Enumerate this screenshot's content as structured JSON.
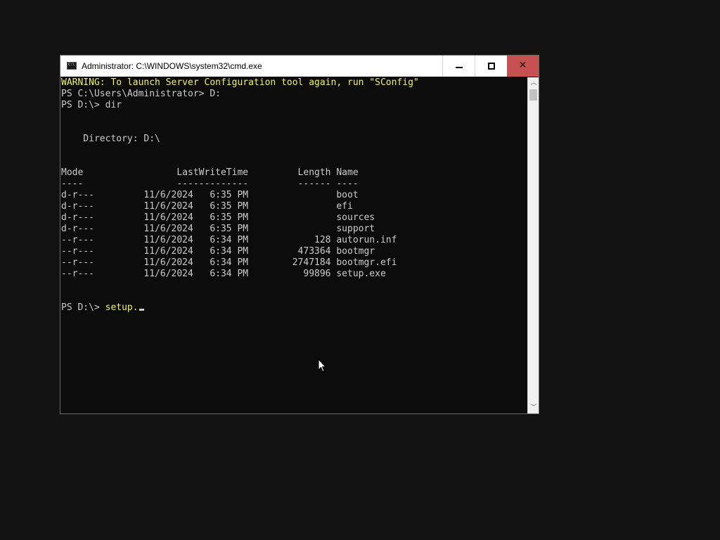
{
  "window": {
    "title": "Administrator: C:\\WINDOWS\\system32\\cmd.exe",
    "icon_label": "C:\\",
    "icon": "console-app-icon",
    "minimize_icon": "minimize-icon",
    "maximize_icon": "maximize-icon",
    "close_glyph": "✕",
    "close_color": "#c75050"
  },
  "console": {
    "lines": [
      "WARNING: To launch Server Configuration tool again, run \"SConfig\"",
      "PS C:\\Users\\Administrator> D:",
      "PS D:\\> dir",
      "",
      "",
      "    Directory: D:\\",
      "",
      "",
      "Mode                 LastWriteTime         Length Name",
      "----                 -------------         ------ ----",
      "d-r---         11/6/2024   6:35 PM                boot",
      "d-r---         11/6/2024   6:35 PM                efi",
      "d-r---         11/6/2024   6:35 PM                sources",
      "d-r---         11/6/2024   6:35 PM                support",
      "--r---         11/6/2024   6:34 PM            128 autorun.inf",
      "--r---         11/6/2024   6:34 PM         473364 bootmgr",
      "--r---         11/6/2024   6:34 PM        2747184 bootmgr.efi",
      "--r---         11/6/2024   6:34 PM          99896 setup.exe",
      "",
      ""
    ],
    "prompt": "PS D:\\> ",
    "current_input": "setup.",
    "warning_color": "#f2f26b",
    "text_color": "#cccccc",
    "background": "#0c0c0c"
  },
  "scrollbar": {
    "up_glyph": "︿",
    "down_glyph": "﹀"
  }
}
